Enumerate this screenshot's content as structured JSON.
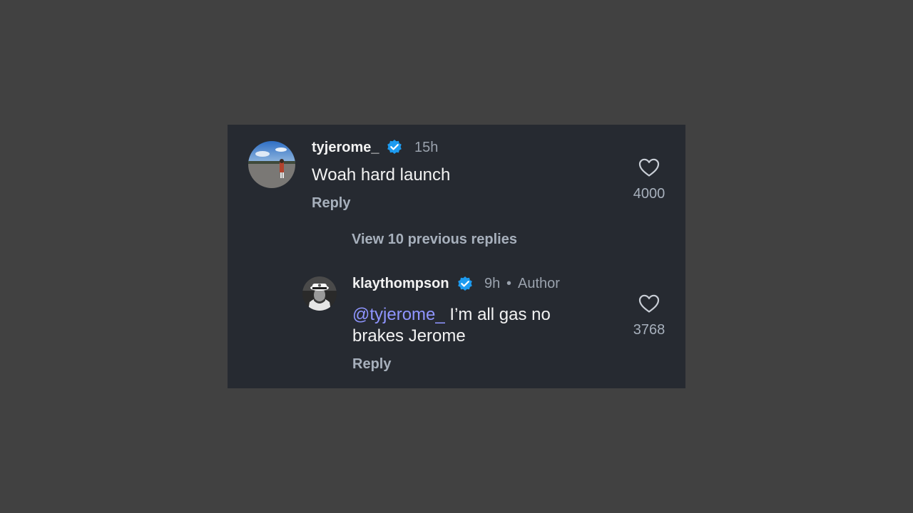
{
  "comments": [
    {
      "username": "tyjerome_",
      "verified": true,
      "time": "15h",
      "text": "Woah hard launch",
      "reply_label": "Reply",
      "like_count": "4000"
    },
    {
      "username": "klaythompson",
      "verified": true,
      "time": "9h",
      "separator": "•",
      "role": "Author",
      "mention": "@tyjerome_",
      "text_line1": " I’m all gas no",
      "text_line2": "brakes Jerome",
      "reply_label": "Reply",
      "like_count": "3768"
    }
  ],
  "view_replies_label": "View 10 previous replies",
  "colors": {
    "background": "#414141",
    "card": "#262a31",
    "verified_badge": "#1d9bf0",
    "mention": "#8f95ff",
    "muted_text": "#a7b0bc"
  },
  "icons": {
    "verified": "verified-badge-icon",
    "like": "heart-outline-icon"
  }
}
